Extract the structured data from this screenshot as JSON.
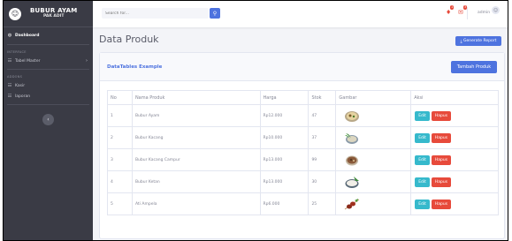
{
  "sidebar": {
    "brand_line1": "BUBUR AYAM",
    "brand_line2": "PAK ADIT",
    "nav_dashboard": "Dashboard",
    "heading_interface": "INTERFACE",
    "nav_tabel_master": "Tabel Master",
    "heading_addons": "ADDONS",
    "nav_kasir": "Kasir",
    "nav_laporan": "laporan"
  },
  "topbar": {
    "search_placeholder": "Search for...",
    "user_name": "admin",
    "alerts_badge": "1",
    "messages_badge": "3"
  },
  "page": {
    "title": "Data Produk",
    "generate_label": "Generate Report"
  },
  "card": {
    "title": "DataTables Example",
    "add_label": "Tambah Produk"
  },
  "table": {
    "columns": [
      "No",
      "Nama Produk",
      "Harga",
      "Stok",
      "Gambar",
      "Aksi"
    ],
    "rows": [
      {
        "no": "1",
        "nama": "Bubur Ayam",
        "harga": "Rp12.000",
        "stok": "47"
      },
      {
        "no": "2",
        "nama": "Bubur Kacang",
        "harga": "Rp10.000",
        "stok": "37"
      },
      {
        "no": "3",
        "nama": "Bubur Kacang Campur",
        "harga": "Rp13.000",
        "stok": "99"
      },
      {
        "no": "4",
        "nama": "Bubur Ketan",
        "harga": "Rp13.000",
        "stok": "30"
      },
      {
        "no": "5",
        "nama": "Ati Ampela",
        "harga": "Rp6.000",
        "stok": "25"
      }
    ],
    "edit_label": "Edit",
    "hapus_label": "Hapus"
  },
  "colors": {
    "sidebar": "#3a3b45",
    "primary": "#4e73df",
    "info": "#36b9cc",
    "danger": "#e74a3b"
  }
}
